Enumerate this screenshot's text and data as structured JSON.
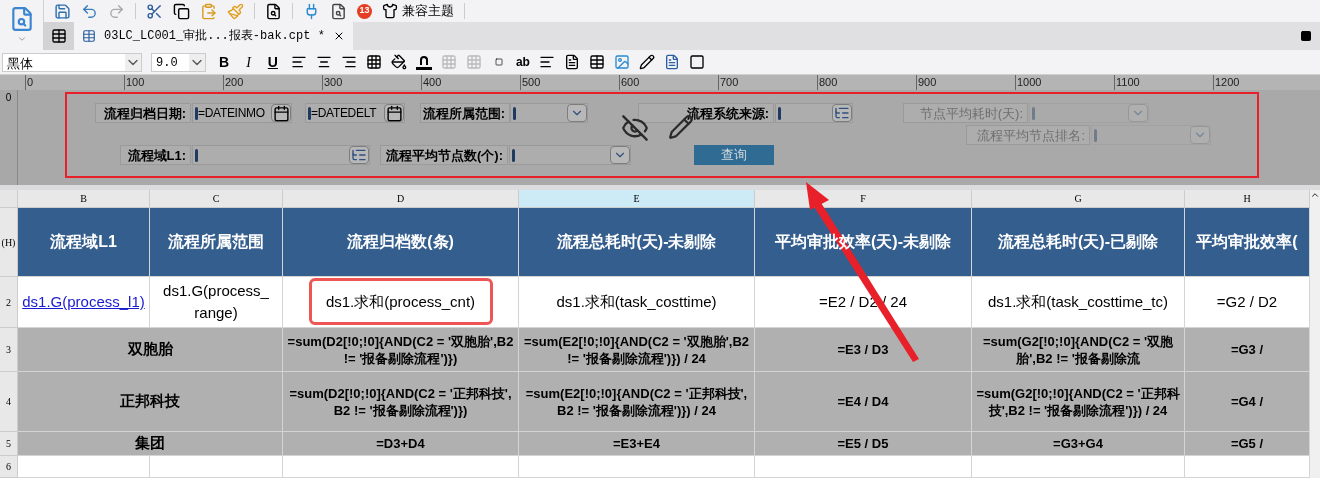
{
  "toolbar": {
    "badge": "13",
    "theme_button": "兼容主题"
  },
  "tabs": [
    {
      "label": "03LC_LC001_审批...报表-bak.cpt *",
      "selected": true
    }
  ],
  "format_bar": {
    "font": "黑体",
    "size": "9.0",
    "bold": "B",
    "italic": "I",
    "underline": "U",
    "text_tool": "ab"
  },
  "ruler": {
    "marks": [
      "0",
      "100",
      "200",
      "300",
      "400",
      "500",
      "600",
      "700",
      "800",
      "900",
      "1000",
      "1100",
      "1200"
    ],
    "vertical_mark": "0"
  },
  "params": [
    {
      "kind": "label",
      "text": "流程归档日期:",
      "disabled": false
    },
    {
      "kind": "date",
      "value": "=DATEINMO",
      "disabled": false
    },
    {
      "kind": "date",
      "value": "=DATEDELT",
      "disabled": false
    },
    {
      "kind": "label",
      "text": "流程所属范围:",
      "disabled": false
    },
    {
      "kind": "combo",
      "disabled": false
    },
    {
      "kind": "label",
      "text": "流程系统来源:",
      "disabled": false
    },
    {
      "kind": "tree",
      "disabled": false
    },
    {
      "kind": "label",
      "text": "节点平均耗时(天):",
      "disabled": true
    },
    {
      "kind": "combo",
      "disabled": true
    },
    {
      "kind": "label",
      "text": "流程平均节点排名:",
      "disabled": true
    },
    {
      "kind": "combo",
      "disabled": true
    },
    {
      "kind": "label",
      "text": "流程域L1:",
      "disabled": false
    },
    {
      "kind": "tree",
      "disabled": false
    },
    {
      "kind": "label",
      "text": "流程平均节点数(个):",
      "disabled": false
    },
    {
      "kind": "combo",
      "disabled": false
    },
    {
      "kind": "button",
      "text": "查询",
      "disabled": false
    }
  ],
  "sheet": {
    "columns": [
      {
        "label": "B",
        "selected": false
      },
      {
        "label": "C",
        "selected": false
      },
      {
        "label": "D",
        "selected": false
      },
      {
        "label": "E",
        "selected": true
      },
      {
        "label": "F",
        "selected": false
      },
      {
        "label": "G",
        "selected": false
      },
      {
        "label": "H",
        "selected": false
      }
    ],
    "rows": [
      {
        "label": "(H)",
        "cells": [
          {
            "kind": "header",
            "text": "流程域L1"
          },
          {
            "kind": "header",
            "text": "流程所属范围"
          },
          {
            "kind": "header",
            "text": "流程归档数(条)"
          },
          {
            "kind": "header",
            "text": "流程总耗时(天)-未剔除"
          },
          {
            "kind": "header",
            "text": "平均审批效率(天)-未剔除"
          },
          {
            "kind": "header",
            "text": "流程总耗时(天)-已剔除"
          },
          {
            "kind": "header",
            "text": "平均审批效率("
          }
        ]
      },
      {
        "label": "2",
        "cells": [
          {
            "kind": "link",
            "text": "ds1.G(process_l1)"
          },
          {
            "kind": "plain",
            "text": "ds1.G(process_ range)"
          },
          {
            "kind": "plain",
            "text": "ds1.求和(process_cnt)"
          },
          {
            "kind": "plain",
            "text": "ds1.求和(task_costtime)"
          },
          {
            "kind": "plain",
            "text": "=E2 / D2 / 24"
          },
          {
            "kind": "plain",
            "text": "ds1.求和(task_costtime_tc)"
          },
          {
            "kind": "plain",
            "text": "=G2 / D2"
          }
        ]
      },
      {
        "label": "3",
        "cells": [
          {
            "kind": "group",
            "text": "双胞胎"
          },
          {
            "kind": "formula",
            "text": "=sum(D2[!0;!0]{AND(C2 = '双胞胎',B2 != '报备剔除流程')})"
          },
          {
            "kind": "formula",
            "text": "=sum(E2[!0;!0]{AND(C2 = '双胞胎',B2 != '报备剔除流程')}) / 24"
          },
          {
            "kind": "formula",
            "text": "=E3 / D3"
          },
          {
            "kind": "formula",
            "text": "=sum(G2[!0;!0]{AND(C2 = '双胞胎',B2 != '报备剔除流"
          },
          {
            "kind": "formula",
            "text": "=G3 /"
          }
        ]
      },
      {
        "label": "4",
        "cells": [
          {
            "kind": "group",
            "text": "正邦科技"
          },
          {
            "kind": "formula",
            "text": "=sum(D2[!0;!0]{AND(C2 = '正邦科技',B2 != '报备剔除流程')})"
          },
          {
            "kind": "formula",
            "text": "=sum(E2[!0;!0]{AND(C2 = '正邦科技',B2 != '报备剔除流程')}) / 24"
          },
          {
            "kind": "formula",
            "text": "=E4 / D4"
          },
          {
            "kind": "formula",
            "text": "=sum(G2[!0;!0]{AND(C2 = '正邦科技',B2 != '报备剔除流程')}) / 24"
          },
          {
            "kind": "formula",
            "text": "=G4 /"
          }
        ]
      },
      {
        "label": "5",
        "cells": [
          {
            "kind": "group",
            "text": "集团"
          },
          {
            "kind": "formula",
            "text": "=D3+D4"
          },
          {
            "kind": "formula",
            "text": "=E3+E4"
          },
          {
            "kind": "formula",
            "text": "=E5 / D5"
          },
          {
            "kind": "formula",
            "text": "=G3+G4"
          },
          {
            "kind": "formula",
            "text": "=G5 /"
          }
        ]
      },
      {
        "label": "6",
        "cells": [
          {
            "kind": "empty"
          },
          {
            "kind": "empty"
          },
          {
            "kind": "empty"
          },
          {
            "kind": "empty"
          },
          {
            "kind": "empty"
          },
          {
            "kind": "empty"
          },
          {
            "kind": "empty"
          }
        ]
      }
    ]
  }
}
